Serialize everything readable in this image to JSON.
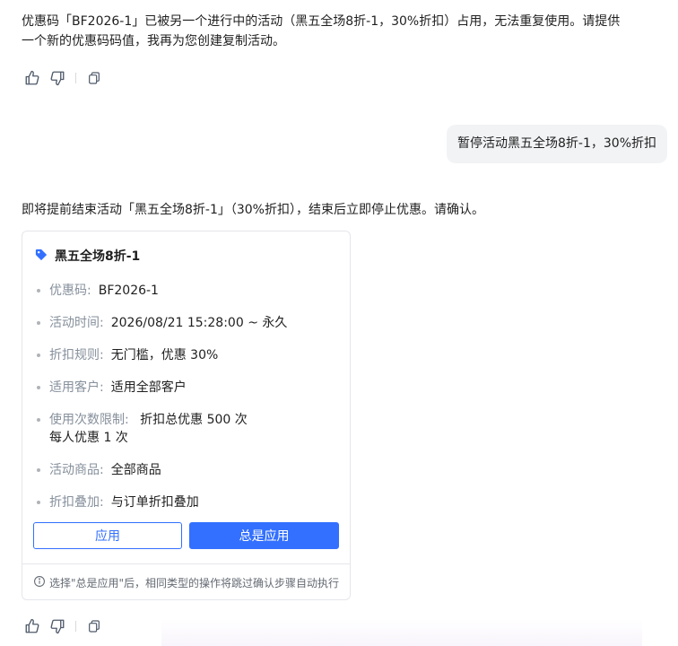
{
  "messages": {
    "assistant1": "优惠码「BF2026-1」已被另一个进行中的活动（黑五全场8折-1，30%折扣）占用，无法重复使用。请提供一个新的优惠码码值，我再为您创建复制活动。",
    "user1": "暂停活动黑五全场8折-1，30%折扣",
    "assistant2": "即将提前结束活动「黑五全场8折-1」（30%折扣），结束后立即停止优惠。请确认。"
  },
  "card": {
    "title": "黑五全场8折-1",
    "tag_icon": "tag-icon",
    "accent_color": "#3370ff",
    "fields": [
      {
        "label": "优惠码:",
        "value": "BF2026-1"
      },
      {
        "label": "活动时间:",
        "value": "2026/08/21 15:28:00 ~ 永久"
      },
      {
        "label": "折扣规则:",
        "value": "无门槛，优惠 30%"
      },
      {
        "label": "适用客户:",
        "value": "适用全部客户"
      },
      {
        "label": "使用次数限制:",
        "value": "折扣总优惠 500 次",
        "value2": "每人优惠 1 次"
      },
      {
        "label": "活动商品:",
        "value": "全部商品"
      },
      {
        "label": "折扣叠加:",
        "value": "与订单折扣叠加"
      }
    ],
    "apply_label": "应用",
    "always_apply_label": "总是应用",
    "footer_note": "选择\"总是应用\"后，相同类型的操作将跳过确认步骤自动执行"
  },
  "icons": {
    "like": "thumbs-up-icon",
    "dislike": "thumbs-down-icon",
    "copy": "copy-icon",
    "info": "info-icon"
  }
}
